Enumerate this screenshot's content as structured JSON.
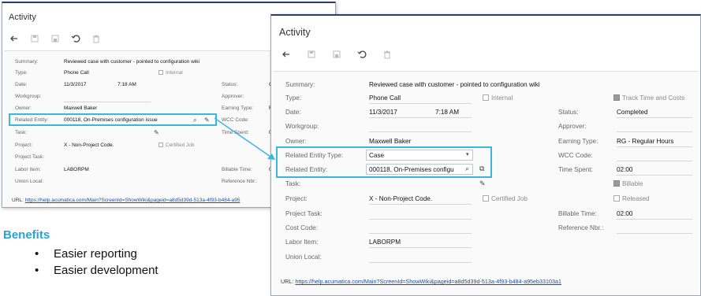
{
  "back": {
    "title": "Activity",
    "summary_label": "Summary:",
    "summary_value": "Reviewed case with customer - pointed to configuration wiki",
    "type_label": "Type:",
    "type_value": "Phone Call",
    "internal_label": "Internal",
    "date_label": "Date:",
    "date_value": "11/3/2017",
    "time_value": "7:18 AM",
    "workgroup_label": "Workgroup:",
    "owner_label": "Owner:",
    "owner_value": "Maxwell Baker",
    "related_label": "Related Entity:",
    "related_value": "000118, On-Premises configuration issue",
    "task_label": "Task:",
    "project_label": "Project:",
    "project_value": "X - Non-Project Code.",
    "certified_label": "Certified Job",
    "project_task_label": "Project Task:",
    "labor_label": "Labor Item:",
    "labor_value": "LABORPM",
    "union_label": "Union Local:",
    "status_label": "Status:",
    "status_value": "C",
    "approver_label": "Approver:",
    "earning_label": "Earning Type:",
    "earning_value": "R",
    "wcc_label": "WCC Code:",
    "time_spent_label": "Time Spent:",
    "time_spent_value": "0",
    "billable_time_label": "Billable Time:",
    "billable_time_value": "0",
    "reference_label": "Reference Nbr.:",
    "url_label": "URL:",
    "url_value": "https://help.acumatica.com/Main?ScreenId=ShowWiki&pageid=a8d5d39d-513a-4f93-b484-a95"
  },
  "front": {
    "title": "Activity",
    "summary_label": "Summary:",
    "summary_value": "Reviewed case with customer - pointed to configuration wiki",
    "type_label": "Type:",
    "type_value": "Phone Call",
    "internal_label": "Internal",
    "track_label": "Track Time and Costs",
    "date_label": "Date:",
    "date_value": "11/3/2017",
    "time_value": "7:18 AM",
    "workgroup_label": "Workgroup:",
    "owner_label": "Owner:",
    "owner_value": "Maxwell Baker",
    "related_type_label": "Related Entity Type:",
    "related_type_value": "Case",
    "related_label": "Related Entity:",
    "related_value": "000118, On-Premises configu",
    "task_label": "Task:",
    "project_label": "Project:",
    "project_value": "X - Non-Project Code.",
    "certified_label": "Certified Job",
    "project_task_label": "Project Task:",
    "cost_code_label": "Cost Code:",
    "labor_label": "Labor Item:",
    "labor_value": "LABORPM",
    "union_label": "Union Local:",
    "status_label": "Status:",
    "status_value": "Completed",
    "approver_label": "Approver:",
    "earning_label": "Earning Type:",
    "earning_value": "RG - Regular Hours",
    "wcc_label": "WCC Code:",
    "time_spent_label": "Time Spent:",
    "time_spent_value": "02:00",
    "billable_label": "Billable",
    "released_label": "Released",
    "billable_time_label": "Billable Time:",
    "billable_time_value": "02:00",
    "reference_label": "Reference Nbr.:",
    "url_label": "URL:",
    "url_value": "https://help.acumatica.com/Main?ScreenId=ShowWiki&pageid=a8d5d39d-513a-4f93-b484-a95eb33103a1"
  },
  "benefits": {
    "heading": "Benefits",
    "items": [
      "Easier reporting",
      "Easier development"
    ]
  },
  "colors": {
    "highlight": "#3bb6e3",
    "benefits_heading": "#2aa2d8",
    "link": "#1a4fa0"
  }
}
